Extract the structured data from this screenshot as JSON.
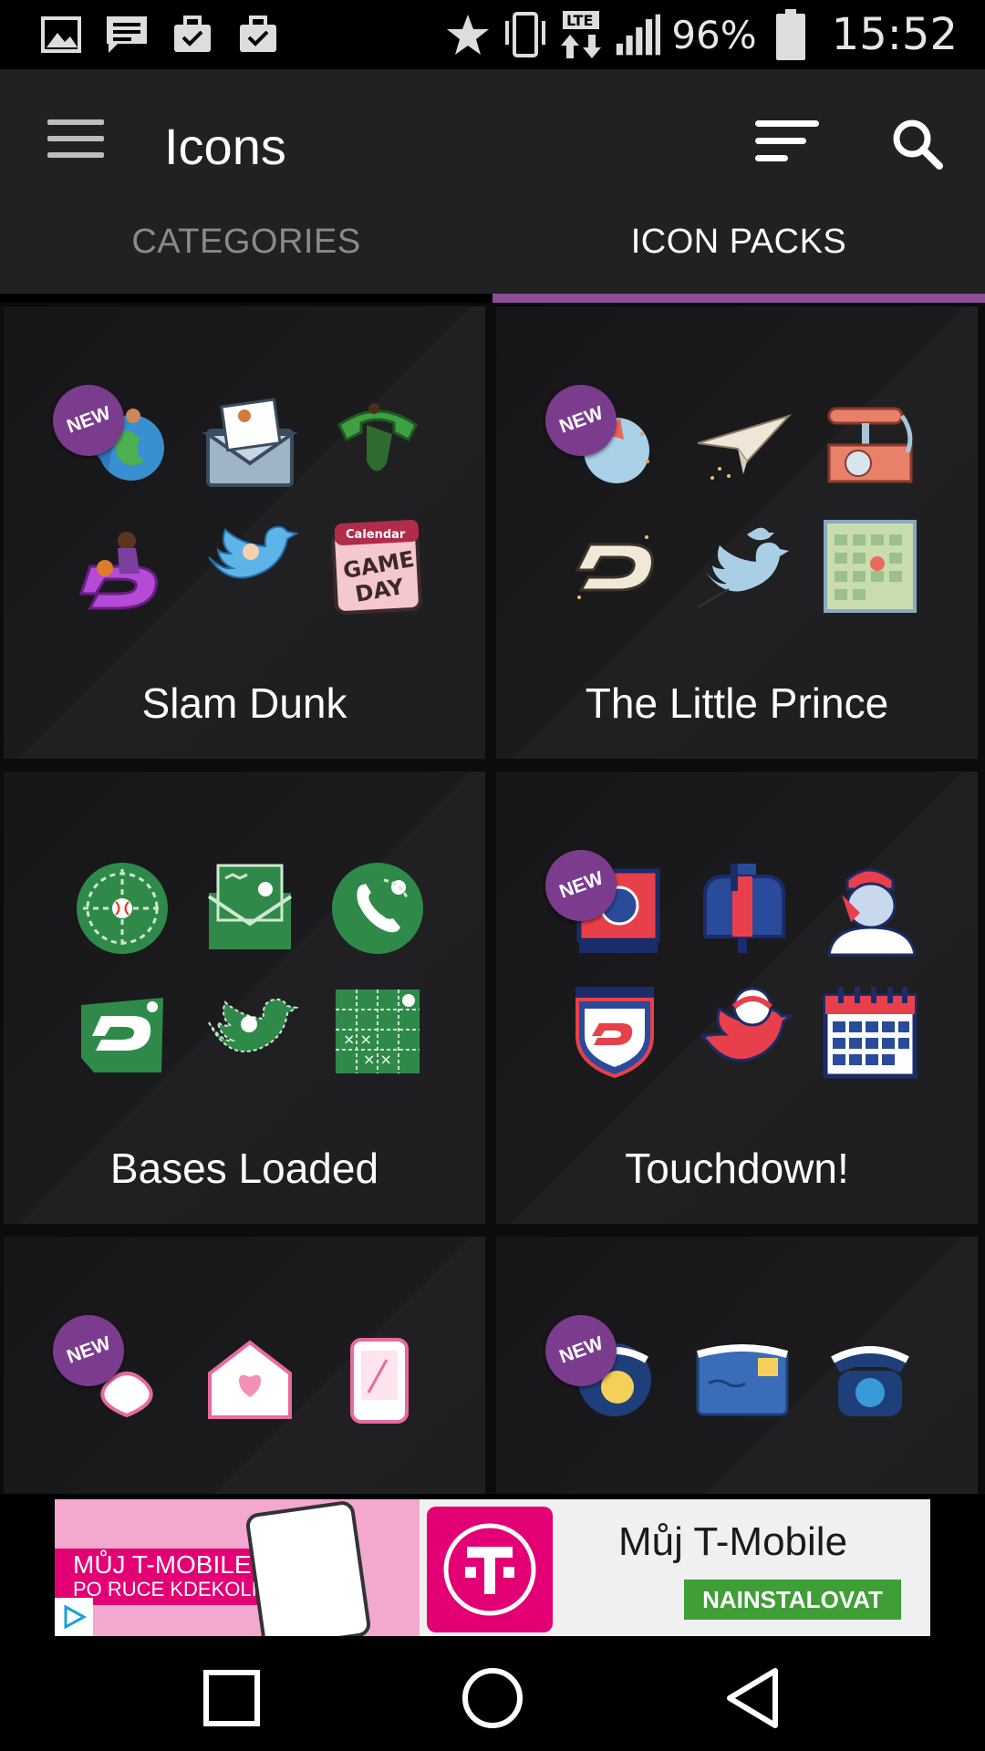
{
  "status_bar": {
    "battery": "96%",
    "time": "15:52",
    "icons": [
      "image-icon",
      "message-icon",
      "briefcase-check-icon",
      "briefcase-check-icon",
      "star-icon",
      "vibrate-icon",
      "lte-icon",
      "signal-icon",
      "battery-icon"
    ]
  },
  "app_bar": {
    "title": "Icons",
    "menu_icon": "hamburger-menu-icon",
    "sort_icon": "sort-icon",
    "search_icon": "search-icon"
  },
  "tabs": [
    {
      "label": "CATEGORIES",
      "active": false
    },
    {
      "label": "ICON PACKS",
      "active": true
    }
  ],
  "accent_color": "#8d4d93",
  "badge_label": "NEW",
  "icon_packs": [
    {
      "name": "Slam Dunk",
      "new": true
    },
    {
      "name": "The Little Prince",
      "new": true
    },
    {
      "name": "Bases Loaded",
      "new": false
    },
    {
      "name": "Touchdown!",
      "new": true
    },
    {
      "name": "",
      "new": true
    },
    {
      "name": "",
      "new": true
    }
  ],
  "ad": {
    "left_line1": "MŮJ T-MOBILE",
    "left_line2": "PO RUCE KDEKOLIV",
    "title": "Můj T-Mobile",
    "cta": "NAINSTALOVAT",
    "brand_color": "#e20074",
    "cta_color": "#3f9e36"
  },
  "nav_bar": {
    "buttons": [
      "recents-button",
      "home-button",
      "back-button"
    ]
  }
}
